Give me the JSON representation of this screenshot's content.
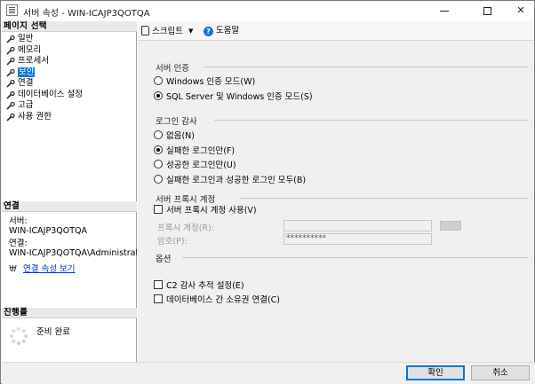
{
  "window": {
    "title": "서버 속성 - WIN-ICAJP3QOTQA"
  },
  "left": {
    "pages_header": "페이지 선택",
    "pages": [
      {
        "label": "일반",
        "selected": false
      },
      {
        "label": "메모리",
        "selected": false
      },
      {
        "label": "프로세서",
        "selected": false
      },
      {
        "label": "보안",
        "selected": true
      },
      {
        "label": "연결",
        "selected": false
      },
      {
        "label": "데이터베이스 설정",
        "selected": false
      },
      {
        "label": "고급",
        "selected": false
      },
      {
        "label": "사용 권한",
        "selected": false
      }
    ],
    "connection_header": "연결",
    "server_label": "서버:",
    "server_value": "WIN-ICAJP3QOTQA",
    "connection_label": "연결:",
    "connection_value": "WIN-ICAJP3QOTQA\\Administrator",
    "view_connection_link": "연결 속성 보기",
    "progress_header": "진행률",
    "progress_status": "준비 완료"
  },
  "toolbar": {
    "script_label": "스크립트",
    "help_label": "도움말"
  },
  "server_auth": {
    "title": "서버 인증",
    "options": [
      {
        "label": "Windows 인증 모드(W)",
        "checked": false
      },
      {
        "label": "SQL Server 및 Windows 인증 모드(S)",
        "checked": true
      }
    ]
  },
  "login_audit": {
    "title": "로그인 감사",
    "options": [
      {
        "label": "없음(N)",
        "checked": false
      },
      {
        "label": "실패한 로그인만(F)",
        "checked": true
      },
      {
        "label": "성공한 로그인만(U)",
        "checked": false
      },
      {
        "label": "실패한 로그인과 성공한 로그인 모두(B)",
        "checked": false
      }
    ]
  },
  "proxy": {
    "title": "서버 프록시 계정",
    "enable_label": "서버 프록시 계정 사용(V)",
    "enable_checked": false,
    "account_label": "프록시 계정(R):",
    "account_value": "",
    "password_label": "암호(P):",
    "password_value": "**********"
  },
  "options": {
    "title": "옵션",
    "c2_label": "C2 감사 추적 설정(E)",
    "c2_checked": false,
    "ownership_label": "데이터베이스 간 소유권 연결(C)",
    "ownership_checked": false
  },
  "buttons": {
    "ok": "확인",
    "cancel": "취소"
  }
}
